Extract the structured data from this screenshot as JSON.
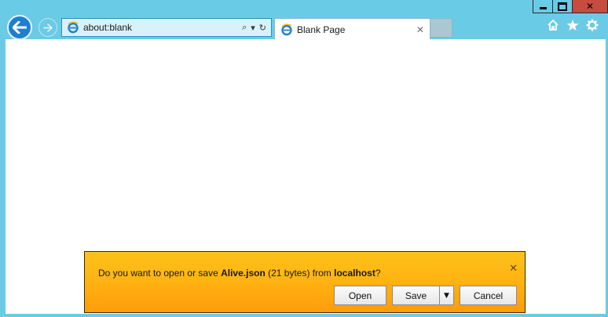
{
  "window": {
    "minimize_icon": "minimize-icon",
    "maximize_icon": "maximize-icon",
    "close_glyph": "✕"
  },
  "nav": {
    "back_icon": "arrow-left-icon",
    "forward_icon": "arrow-right-icon"
  },
  "address_bar": {
    "value": "about:blank",
    "search_glyph": "⌕",
    "dropdown_glyph": "▾",
    "refresh_glyph": "↻"
  },
  "tab": {
    "title": "Blank Page",
    "close_glyph": "✕"
  },
  "commands": {
    "home_icon": "home-icon",
    "favorites_icon": "star-icon",
    "tools_icon": "gear-icon"
  },
  "notification": {
    "prefix": "Do you want to open or save ",
    "file_name": "Alive.json",
    "size_text": " (21 bytes) from ",
    "source": "localhost",
    "suffix": "?",
    "close_glyph": "✕",
    "open_label": "Open",
    "save_label": "Save",
    "save_menu_glyph": "▼",
    "cancel_label": "Cancel"
  },
  "colors": {
    "frame": "#6acbe6",
    "notification_top": "#fcc21a",
    "notification_bottom": "#ff9c0a",
    "close_button": "#c74b3f",
    "back_button": "#1e7fd1"
  }
}
